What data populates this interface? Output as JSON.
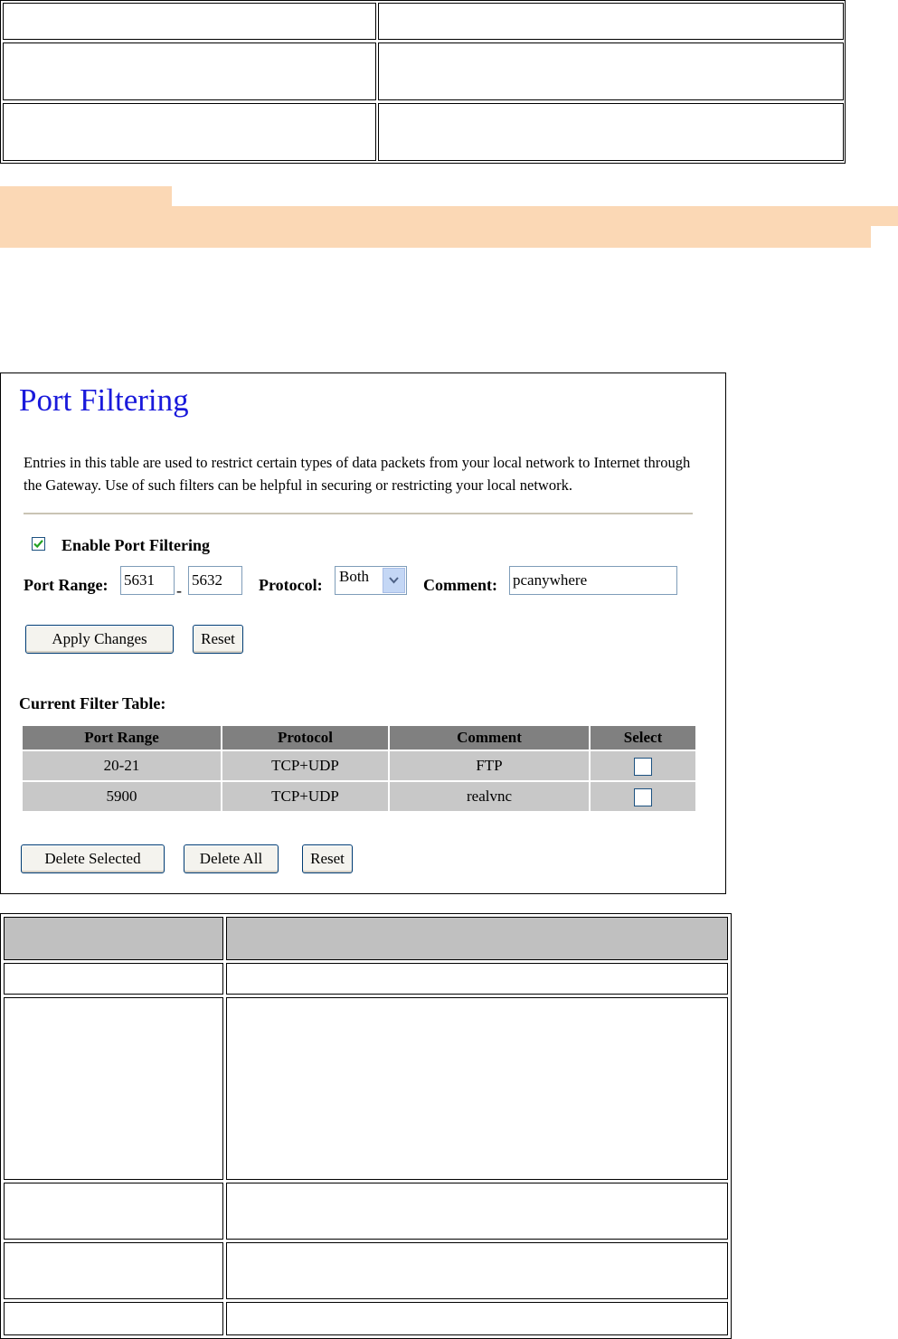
{
  "panel": {
    "title": "Port Filtering",
    "description": "Entries in this table are used to restrict certain types of data packets from your local network to Internet through the Gateway. Use of such filters can be helpful in securing or restricting your local network.",
    "enable_label": "Enable Port Filtering",
    "enable_checked": true,
    "port_range_label": "Port Range:",
    "port_from": "5631",
    "port_separator": "-",
    "port_to": "5632",
    "protocol_label": "Protocol:",
    "protocol_value": "Both",
    "comment_label": "Comment:",
    "comment_value": "pcanywhere",
    "apply_button": "Apply Changes",
    "reset_button": "Reset",
    "table_label": "Current Filter Table:",
    "table_headers": [
      "Port Range",
      "Protocol",
      "Comment",
      "Select"
    ],
    "rows": [
      {
        "port_range": "20-21",
        "protocol": "TCP+UDP",
        "comment": "FTP",
        "selected": false
      },
      {
        "port_range": "5900",
        "protocol": "TCP+UDP",
        "comment": "realvnc",
        "selected": false
      }
    ],
    "delete_selected_button": "Delete Selected",
    "delete_all_button": "Delete All",
    "reset_button_2": "Reset"
  },
  "colors": {
    "title": "#1a1adb",
    "highlight": "#fbd8b5",
    "table_header": "#808080",
    "table_cell": "#c8c8c8"
  }
}
